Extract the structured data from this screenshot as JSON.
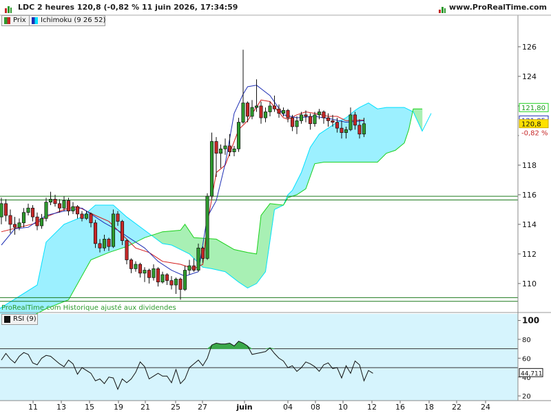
{
  "header": {
    "title": "LDC 2 heures 120,8 (-0,82 % 11 juin 2026, 17:34:59",
    "site": "www.ProRealTime.com",
    "legend_price": "Prix",
    "legend_ichimoku": "Ichimoku (9 26 52)",
    "watermark": "ProRealTime.com  Historique ajusté aux dividendes",
    "legend_rsi": "RSI (9)"
  },
  "colors": {
    "bull": "#2e9a2e",
    "bear": "#c62828",
    "tenkan": "#d21818",
    "kijun": "#1e2fb5",
    "span_a": "#00e0ff",
    "span_b": "#1bd11b",
    "cloud_bull": "#9cf0ff",
    "cloud_bear": "#a8f0b4",
    "rsi_bg": "#d6f4fd",
    "rsi_line": "#111111"
  },
  "chart_data": [
    {
      "type": "candlestick",
      "title": "LDC 2 heures",
      "x_tick_labels": [
        "11",
        "13",
        "15",
        "19",
        "21",
        "25",
        "27",
        "juin",
        "04",
        "08",
        "10",
        "12",
        "16",
        "18",
        "22",
        "24"
      ],
      "y_ticks": [
        110,
        112,
        114,
        116,
        118,
        120,
        122,
        124,
        126
      ],
      "y_tick_labels": [
        "110",
        "112",
        "114",
        "116",
        "118",
        "",
        "",
        "124",
        "126"
      ],
      "ylim": [
        108.6,
        127.3
      ],
      "last_price": 120.8,
      "last_price_label": "120,8",
      "change_label": "-0,82 %",
      "tenkan_label": "121,05",
      "spanb_label": "121,80",
      "horizontal_levels": [
        115.9,
        115.65,
        109.05,
        108.8
      ],
      "candles": [
        [
          114.5,
          115.8,
          114.0,
          115.4
        ],
        [
          115.4,
          115.7,
          114.2,
          114.6
        ],
        [
          114.6,
          115.0,
          113.4,
          114.0
        ],
        [
          114.0,
          114.5,
          113.3,
          113.8
        ],
        [
          113.8,
          114.4,
          113.6,
          114.1
        ],
        [
          114.1,
          115.1,
          113.8,
          114.8
        ],
        [
          114.8,
          115.4,
          114.6,
          115.1
        ],
        [
          115.1,
          115.3,
          114.2,
          114.5
        ],
        [
          114.5,
          114.8,
          113.6,
          113.9
        ],
        [
          113.9,
          114.7,
          113.7,
          114.4
        ],
        [
          114.4,
          115.8,
          114.2,
          115.5
        ],
        [
          115.5,
          116.2,
          115.3,
          115.7
        ],
        [
          115.7,
          116.0,
          115.2,
          115.4
        ],
        [
          115.4,
          115.7,
          114.8,
          115.1
        ],
        [
          115.1,
          115.9,
          114.9,
          115.6
        ],
        [
          115.6,
          115.8,
          114.6,
          114.9
        ],
        [
          114.9,
          115.5,
          114.7,
          115.2
        ],
        [
          115.2,
          115.3,
          114.4,
          114.7
        ],
        [
          114.7,
          114.9,
          114.2,
          114.4
        ],
        [
          114.4,
          114.9,
          114.3,
          114.7
        ],
        [
          114.7,
          114.8,
          113.8,
          114.1
        ],
        [
          114.1,
          114.3,
          112.4,
          112.7
        ],
        [
          112.7,
          113.0,
          112.1,
          112.4
        ],
        [
          112.4,
          113.3,
          112.2,
          113.0
        ],
        [
          113.0,
          113.1,
          112.2,
          112.5
        ],
        [
          112.5,
          115.0,
          112.4,
          114.7
        ],
        [
          114.7,
          114.9,
          113.9,
          114.2
        ],
        [
          114.2,
          114.3,
          112.6,
          112.9
        ],
        [
          112.9,
          113.0,
          111.3,
          111.6
        ],
        [
          111.6,
          111.7,
          110.7,
          111.0
        ],
        [
          111.0,
          111.5,
          110.8,
          111.3
        ],
        [
          111.3,
          111.4,
          110.4,
          110.7
        ],
        [
          110.7,
          111.1,
          110.1,
          110.9
        ],
        [
          110.9,
          111.0,
          110.0,
          110.4
        ],
        [
          110.4,
          111.3,
          110.2,
          111.0
        ],
        [
          111.0,
          111.1,
          109.8,
          110.1
        ],
        [
          110.1,
          110.8,
          110.0,
          110.6
        ],
        [
          110.6,
          110.7,
          109.9,
          110.2
        ],
        [
          110.2,
          110.5,
          109.6,
          109.9
        ],
        [
          109.9,
          110.4,
          109.3,
          110.3
        ],
        [
          110.3,
          110.4,
          108.9,
          109.6
        ],
        [
          109.6,
          111.2,
          109.5,
          110.9
        ],
        [
          110.9,
          111.6,
          110.6,
          111.2
        ],
        [
          111.2,
          111.7,
          110.8,
          110.9
        ],
        [
          110.9,
          112.7,
          110.8,
          112.4
        ],
        [
          112.4,
          112.5,
          111.4,
          111.7
        ],
        [
          111.7,
          116.1,
          111.6,
          115.9
        ],
        [
          115.9,
          120.2,
          115.7,
          119.6
        ],
        [
          119.6,
          119.9,
          117.2,
          118.8
        ],
        [
          118.8,
          119.4,
          117.8,
          119.1
        ],
        [
          119.1,
          119.8,
          118.7,
          119.3
        ],
        [
          119.3,
          120.1,
          118.6,
          118.9
        ],
        [
          118.9,
          119.3,
          118.6,
          119.1
        ],
        [
          119.1,
          121.2,
          118.9,
          120.9
        ],
        [
          120.9,
          125.8,
          120.8,
          122.2
        ],
        [
          122.2,
          122.3,
          120.9,
          121.3
        ],
        [
          121.3,
          122.4,
          121.1,
          121.9
        ],
        [
          121.9,
          123.8,
          121.6,
          122.0
        ],
        [
          122.0,
          122.3,
          120.8,
          121.2
        ],
        [
          121.2,
          121.9,
          120.9,
          121.6
        ],
        [
          121.6,
          122.3,
          121.3,
          122.0
        ],
        [
          122.0,
          122.7,
          121.6,
          121.8
        ],
        [
          121.8,
          122.1,
          121.2,
          121.5
        ],
        [
          121.5,
          121.9,
          121.3,
          121.7
        ],
        [
          121.7,
          121.8,
          120.9,
          121.2
        ],
        [
          121.2,
          121.4,
          120.3,
          120.6
        ],
        [
          120.6,
          121.3,
          120.1,
          121.0
        ],
        [
          121.0,
          121.6,
          120.8,
          121.4
        ],
        [
          121.4,
          121.7,
          120.9,
          121.3
        ],
        [
          121.3,
          121.5,
          120.4,
          120.8
        ],
        [
          120.8,
          121.6,
          120.6,
          121.4
        ],
        [
          121.4,
          121.8,
          121.1,
          121.6
        ],
        [
          121.6,
          121.7,
          120.8,
          121.2
        ],
        [
          121.2,
          121.5,
          120.6,
          121.0
        ],
        [
          121.0,
          121.4,
          120.6,
          120.9
        ],
        [
          120.9,
          121.2,
          120.2,
          120.5
        ],
        [
          120.5,
          121.0,
          119.8,
          120.2
        ],
        [
          120.2,
          120.6,
          119.8,
          120.4
        ],
        [
          120.4,
          121.9,
          120.3,
          121.4
        ],
        [
          121.4,
          121.6,
          120.4,
          120.7
        ],
        [
          120.7,
          121.1,
          119.8,
          120.1
        ],
        [
          120.1,
          121.2,
          119.9,
          120.8
        ]
      ],
      "tenkan_sen": [
        [
          0,
          113.5
        ],
        [
          4,
          113.8
        ],
        [
          8,
          114.1
        ],
        [
          10,
          114.5
        ],
        [
          14,
          115.0
        ],
        [
          17,
          115.2
        ],
        [
          19,
          114.9
        ],
        [
          21,
          114.6
        ],
        [
          24,
          114.2
        ],
        [
          27,
          113.3
        ],
        [
          30,
          112.4
        ],
        [
          33,
          112.1
        ],
        [
          36,
          111.5
        ],
        [
          40,
          111.3
        ],
        [
          43,
          111.0
        ],
        [
          45,
          111.3
        ],
        [
          46,
          114.0
        ],
        [
          48,
          117.5
        ],
        [
          50,
          118.0
        ],
        [
          53,
          120.4
        ],
        [
          55,
          121.0
        ],
        [
          58,
          122.4
        ],
        [
          60,
          122.3
        ],
        [
          63,
          121.2
        ],
        [
          64,
          121.1
        ],
        [
          66,
          121.4
        ],
        [
          68,
          121.6
        ],
        [
          70,
          121.5
        ],
        [
          73,
          121.3
        ],
        [
          75,
          121.3
        ],
        [
          77,
          121.0
        ],
        [
          81,
          121.05
        ]
      ],
      "kijun_sen": [
        [
          0,
          112.6
        ],
        [
          3,
          113.7
        ],
        [
          6,
          113.8
        ],
        [
          10,
          114.6
        ],
        [
          14,
          114.9
        ],
        [
          18,
          115.1
        ],
        [
          20,
          114.7
        ],
        [
          23,
          114.1
        ],
        [
          26,
          113.6
        ],
        [
          29,
          113.0
        ],
        [
          32,
          112.4
        ],
        [
          35,
          111.5
        ],
        [
          38,
          110.9
        ],
        [
          41,
          110.5
        ],
        [
          44,
          110.8
        ],
        [
          46,
          114.5
        ],
        [
          48,
          115.6
        ],
        [
          50,
          118.1
        ],
        [
          52,
          121.5
        ],
        [
          54,
          122.8
        ],
        [
          55,
          123.3
        ],
        [
          57,
          123.4
        ],
        [
          60,
          122.7
        ],
        [
          63,
          121.4
        ],
        [
          66,
          121.2
        ],
        [
          70,
          121.3
        ],
        [
          74,
          121.1
        ],
        [
          77,
          120.9
        ],
        [
          81,
          121.0
        ]
      ],
      "senkou_span_a": [
        [
          -2,
          108.0
        ],
        [
          8,
          109.9
        ],
        [
          10,
          112.8
        ],
        [
          14,
          114.0
        ],
        [
          18,
          114.5
        ],
        [
          21,
          115.3
        ],
        [
          25,
          115.3
        ],
        [
          28,
          114.5
        ],
        [
          32,
          113.6
        ],
        [
          36,
          112.7
        ],
        [
          38,
          112.6
        ],
        [
          42,
          112.0
        ],
        [
          45,
          111.1
        ],
        [
          47,
          111.0
        ],
        [
          50,
          110.8
        ],
        [
          53,
          110.1
        ],
        [
          55,
          109.7
        ],
        [
          57,
          110.0
        ],
        [
          59,
          110.8
        ],
        [
          61,
          115.0
        ],
        [
          63,
          115.3
        ],
        [
          64,
          116.0
        ],
        [
          65,
          116.3
        ],
        [
          67,
          117.5
        ],
        [
          69,
          119.2
        ],
        [
          71,
          120.1
        ],
        [
          73,
          120.5
        ],
        [
          75,
          120.9
        ],
        [
          77,
          121.2
        ],
        [
          79,
          121.7
        ],
        [
          80,
          121.9
        ],
        [
          82,
          122.2
        ],
        [
          84,
          121.8
        ],
        [
          86,
          121.9
        ],
        [
          90,
          121.9
        ],
        [
          92,
          121.6
        ],
        [
          94,
          120.3
        ],
        [
          96,
          121.5
        ]
      ],
      "senkou_span_b": [
        [
          -2,
          107.0
        ],
        [
          5,
          107.5
        ],
        [
          10,
          108.3
        ],
        [
          15,
          108.9
        ],
        [
          20,
          111.6
        ],
        [
          24,
          112.1
        ],
        [
          28,
          112.5
        ],
        [
          32,
          113.1
        ],
        [
          36,
          113.5
        ],
        [
          40,
          113.6
        ],
        [
          41,
          114.0
        ],
        [
          43,
          113.1
        ],
        [
          48,
          113.0
        ],
        [
          52,
          112.3
        ],
        [
          55,
          112.1
        ],
        [
          57,
          112.0
        ],
        [
          58,
          114.6
        ],
        [
          60,
          115.4
        ],
        [
          63,
          115.3
        ],
        [
          64,
          115.8
        ],
        [
          66,
          116.0
        ],
        [
          68,
          116.4
        ],
        [
          70,
          118.1
        ],
        [
          72,
          118.2
        ],
        [
          75,
          118.2
        ],
        [
          80,
          118.2
        ],
        [
          84,
          118.2
        ],
        [
          86,
          118.8
        ],
        [
          88,
          119.0
        ],
        [
          90,
          119.5
        ],
        [
          91,
          120.4
        ],
        [
          92,
          121.8
        ],
        [
          94,
          121.8
        ]
      ]
    },
    {
      "type": "line",
      "title": "RSI (9)",
      "y_ticks": [
        20,
        40,
        60,
        80,
        100
      ],
      "y_tick_labels": [
        "20",
        "40",
        "60",
        "80",
        "100"
      ],
      "ylim": [
        15,
        107
      ],
      "levels": [
        70,
        50
      ],
      "last_value_label": "44,711",
      "values": [
        58,
        65,
        59,
        55,
        62,
        66,
        64,
        55,
        53,
        60,
        63,
        62,
        58,
        54,
        51,
        58,
        54,
        43,
        50,
        47,
        44,
        36,
        38,
        33,
        40,
        39,
        27,
        38,
        34,
        38,
        45,
        56,
        51,
        38,
        41,
        44,
        41,
        41,
        34,
        48,
        33,
        38,
        50,
        54,
        58,
        52,
        60,
        74,
        76,
        75,
        75,
        76,
        73,
        78,
        76,
        73,
        64,
        65,
        66,
        67,
        71,
        65,
        60,
        57,
        50,
        52,
        46,
        50,
        56,
        54,
        51,
        46,
        53,
        55,
        49,
        50,
        39,
        52,
        44,
        57,
        53,
        36,
        47,
        44
      ]
    }
  ]
}
